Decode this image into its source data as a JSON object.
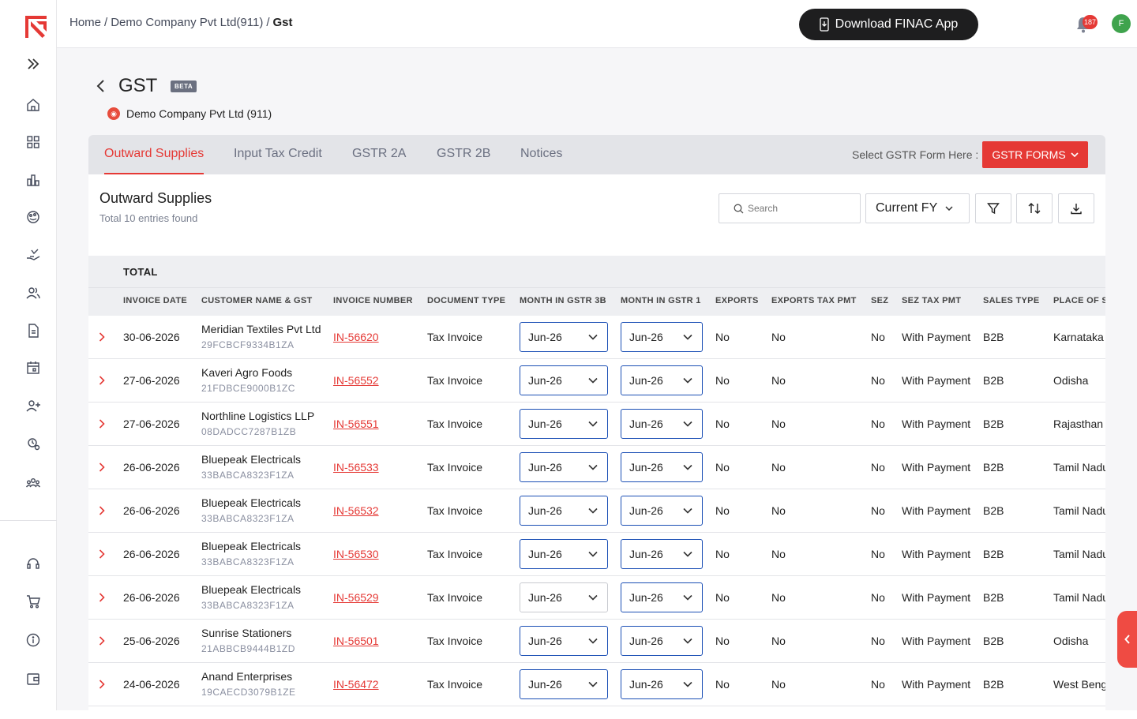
{
  "breadcrumb": {
    "home": "Home",
    "sep": "/",
    "company": "Demo Company Pvt Ltd(911)",
    "current": "Gst"
  },
  "header": {
    "download_app": "Download FINAC App",
    "notification_count": "187",
    "avatar_initial": "F"
  },
  "page": {
    "title": "GST",
    "badge": "BETA",
    "company": "Demo Company Pvt Ltd (911)"
  },
  "tabs": [
    "Outward Supplies",
    "Input Tax Credit",
    "GSTR 2A",
    "GSTR 2B",
    "Notices"
  ],
  "gstr": {
    "label": "Select GSTR Form Here :",
    "button": "GSTR FORMS"
  },
  "section": {
    "title": "Outward Supplies",
    "subtitle": "Total 10 entries found"
  },
  "toolbar": {
    "search_placeholder": "Search",
    "fy": "Current FY"
  },
  "table": {
    "total_label": "TOTAL",
    "columns": [
      "INVOICE DATE",
      "CUSTOMER NAME & GST",
      "INVOICE NUMBER",
      "DOCUMENT TYPE",
      "MONTH IN GSTR 3B",
      "MONTH IN GSTR 1",
      "EXPORTS",
      "EXPORTS TAX PMT",
      "SEZ",
      "SEZ TAX PMT",
      "SALES TYPE",
      "PLACE OF S"
    ],
    "rows": [
      {
        "date": "30-06-2026",
        "customer": "Meridian Textiles Pvt Ltd",
        "gst": "29FCBCF9334B1ZA",
        "invoice": "IN-56620",
        "doc": "Tax Invoice",
        "m3b": "Jun-26",
        "m1": "Jun-26",
        "exports": "No",
        "exports_tax": "No",
        "sez": "No",
        "sez_tax": "With Payment",
        "sales": "B2B",
        "place": "Karnataka",
        "m3b_gray": false
      },
      {
        "date": "27-06-2026",
        "customer": "Kaveri Agro Foods",
        "gst": "21FDBCE9000B1ZC",
        "invoice": "IN-56552",
        "doc": "Tax Invoice",
        "m3b": "Jun-26",
        "m1": "Jun-26",
        "exports": "No",
        "exports_tax": "No",
        "sez": "No",
        "sez_tax": "With Payment",
        "sales": "B2B",
        "place": "Odisha",
        "m3b_gray": false
      },
      {
        "date": "27-06-2026",
        "customer": "Northline Logistics LLP",
        "gst": "08DADCC7287B1ZB",
        "invoice": "IN-56551",
        "doc": "Tax Invoice",
        "m3b": "Jun-26",
        "m1": "Jun-26",
        "exports": "No",
        "exports_tax": "No",
        "sez": "No",
        "sez_tax": "With Payment",
        "sales": "B2B",
        "place": "Rajasthan",
        "m3b_gray": false
      },
      {
        "date": "26-06-2026",
        "customer": "Bluepeak Electricals",
        "gst": "33BABCA8323F1ZA",
        "invoice": "IN-56533",
        "doc": "Tax Invoice",
        "m3b": "Jun-26",
        "m1": "Jun-26",
        "exports": "No",
        "exports_tax": "No",
        "sez": "No",
        "sez_tax": "With Payment",
        "sales": "B2B",
        "place": "Tamil Nadu",
        "m3b_gray": false
      },
      {
        "date": "26-06-2026",
        "customer": "Bluepeak Electricals",
        "gst": "33BABCA8323F1ZA",
        "invoice": "IN-56532",
        "doc": "Tax Invoice",
        "m3b": "Jun-26",
        "m1": "Jun-26",
        "exports": "No",
        "exports_tax": "No",
        "sez": "No",
        "sez_tax": "With Payment",
        "sales": "B2B",
        "place": "Tamil Nadu",
        "m3b_gray": false
      },
      {
        "date": "26-06-2026",
        "customer": "Bluepeak Electricals",
        "gst": "33BABCA8323F1ZA",
        "invoice": "IN-56530",
        "doc": "Tax Invoice",
        "m3b": "Jun-26",
        "m1": "Jun-26",
        "exports": "No",
        "exports_tax": "No",
        "sez": "No",
        "sez_tax": "With Payment",
        "sales": "B2B",
        "place": "Tamil Nadu",
        "m3b_gray": false
      },
      {
        "date": "26-06-2026",
        "customer": "Bluepeak Electricals",
        "gst": "33BABCA8323F1ZA",
        "invoice": "IN-56529",
        "doc": "Tax Invoice",
        "m3b": "Jun-26",
        "m1": "Jun-26",
        "exports": "No",
        "exports_tax": "No",
        "sez": "No",
        "sez_tax": "With Payment",
        "sales": "B2B",
        "place": "Tamil Nadu",
        "m3b_gray": true
      },
      {
        "date": "25-06-2026",
        "customer": "Sunrise Stationers",
        "gst": "21ABBCB9444B1ZD",
        "invoice": "IN-56501",
        "doc": "Tax Invoice",
        "m3b": "Jun-26",
        "m1": "Jun-26",
        "exports": "No",
        "exports_tax": "No",
        "sez": "No",
        "sez_tax": "With Payment",
        "sales": "B2B",
        "place": "Odisha",
        "m3b_gray": false
      },
      {
        "date": "24-06-2026",
        "customer": "Anand Enterprises",
        "gst": "19CAECD3079B1ZE",
        "invoice": "IN-56472",
        "doc": "Tax Invoice",
        "m3b": "Jun-26",
        "m1": "Jun-26",
        "exports": "No",
        "exports_tax": "No",
        "sez": "No",
        "sez_tax": "With Payment",
        "sales": "B2B",
        "place": "West Bengal",
        "m3b_gray": false
      }
    ]
  },
  "sidebar_icons": [
    "expand-icon",
    "home-icon",
    "grid-icon",
    "chart-icon",
    "palette-icon",
    "hand-coin-icon",
    "users-icon",
    "document-icon",
    "calendar-icon",
    "user-add-icon",
    "settings-clock-icon",
    "team-icon",
    "support-icon",
    "cart-icon",
    "info-icon",
    "wallet-icon"
  ],
  "colors": {
    "accent": "#e53935",
    "select_border": "#1b4fb5",
    "dark_button": "#1e1e1f"
  }
}
